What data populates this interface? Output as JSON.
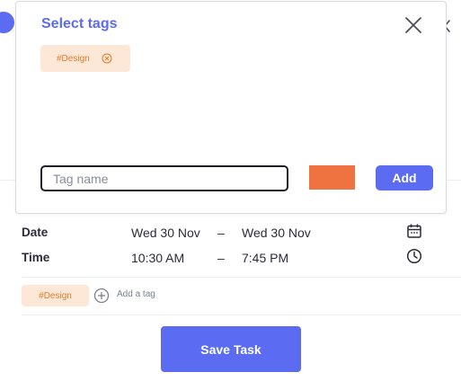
{
  "modal": {
    "title": "Select tags",
    "selected_tags": [
      {
        "label": "#Design"
      }
    ],
    "tag_input": {
      "value": "",
      "placeholder": "Tag name"
    },
    "color_swatch": "#ef7340",
    "add_label": "Add"
  },
  "form": {
    "date": {
      "label": "Date",
      "start": "Wed 30 Nov",
      "separator": "–",
      "end": "Wed 30 Nov"
    },
    "time": {
      "label": "Time",
      "start": "10:30 AM",
      "separator": "–",
      "end": "7:45 PM"
    },
    "tags": [
      {
        "label": "#Design"
      }
    ],
    "add_tag_label": "Add a tag",
    "save_label": "Save Task"
  },
  "colors": {
    "accent": "#5b6cf2",
    "tag_bg": "#fde8d8",
    "tag_text": "#e8792b"
  }
}
